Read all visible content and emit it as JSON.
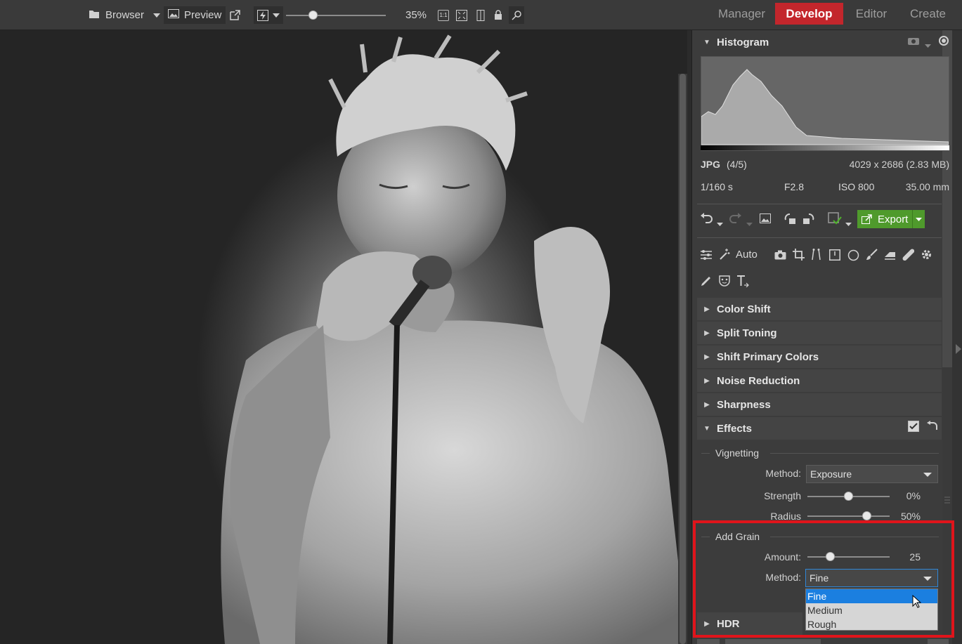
{
  "topbar": {
    "browser_label": "Browser",
    "preview_label": "Preview",
    "zoom_value": "35%",
    "zoom_fraction": 0.27,
    "fit_1to1": "1:1",
    "modes": [
      "Manager",
      "Develop",
      "Editor",
      "Create"
    ],
    "active_mode": "Develop"
  },
  "histogram": {
    "title": "Histogram",
    "format": "JPG",
    "index": "(4/5)",
    "dimensions": "4029 x 2686 (2.83 MB)",
    "shutter": "1/160 s",
    "aperture": "F2.8",
    "iso": "ISO 800",
    "focal": "35.00 mm"
  },
  "toolbar": {
    "export_label": "Export",
    "auto_label": "Auto"
  },
  "sections": {
    "color_shift": "Color Shift",
    "split_toning": "Split Toning",
    "shift_primary": "Shift Primary Colors",
    "noise_reduction": "Noise Reduction",
    "sharpness": "Sharpness",
    "effects": "Effects",
    "hdr": "HDR"
  },
  "vignetting": {
    "title": "Vignetting",
    "method_label": "Method:",
    "method_value": "Exposure",
    "strength_label": "Strength",
    "strength_value": "0%",
    "strength_fraction": 0.5,
    "radius_label": "Radius",
    "radius_value": "50%",
    "radius_fraction": 0.72
  },
  "grain": {
    "title": "Add Grain",
    "amount_label": "Amount:",
    "amount_value": "25",
    "amount_fraction": 0.28,
    "method_label": "Method:",
    "method_value": "Fine",
    "options": [
      "Fine",
      "Medium",
      "Rough"
    ],
    "selected_option": "Fine"
  },
  "colors": {
    "accent": "#c3262c",
    "export_green": "#4f9a2c",
    "highlight": "#e0141b",
    "selection_blue": "#1b7fe0"
  }
}
